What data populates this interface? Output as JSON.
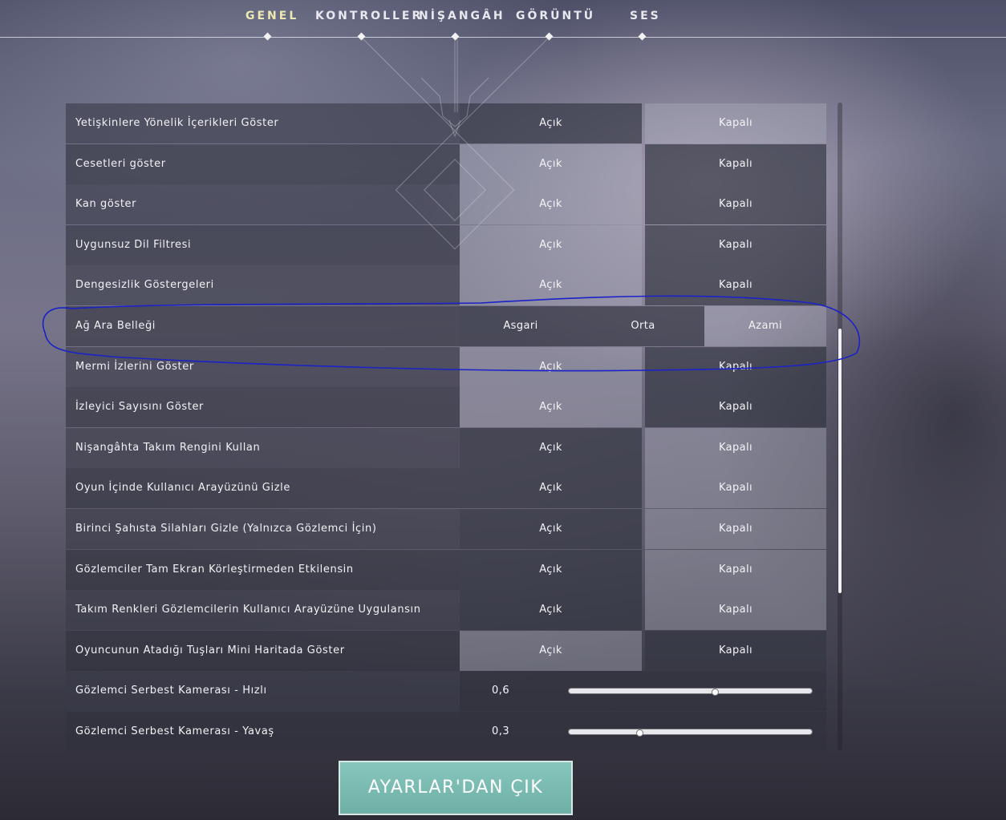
{
  "nav": {
    "tabs": [
      {
        "label": "GENEL",
        "active": true
      },
      {
        "label": "KONTROLLER",
        "active": false
      },
      {
        "label": "NİŞANGÂH",
        "active": false
      },
      {
        "label": "GÖRÜNTÜ",
        "active": false
      },
      {
        "label": "SES",
        "active": false
      }
    ]
  },
  "settings": {
    "rows": [
      {
        "label": "Yetişkinlere Yönelik İçerikleri Göster",
        "options": [
          "Açık",
          "Kapalı"
        ],
        "selected": 1
      },
      {
        "label": "Cesetleri göster",
        "options": [
          "Açık",
          "Kapalı"
        ],
        "selected": 0
      },
      {
        "label": "Kan göster",
        "options": [
          "Açık",
          "Kapalı"
        ],
        "selected": 0
      },
      {
        "label": "Uygunsuz Dil Filtresi",
        "options": [
          "Açık",
          "Kapalı"
        ],
        "selected": 0
      },
      {
        "label": "Dengesizlik Göstergeleri",
        "options": [
          "Açık",
          "Kapalı"
        ],
        "selected": 0
      },
      {
        "label": "Ağ Ara Belleği",
        "options": [
          "Asgari",
          "Orta",
          "Azami"
        ],
        "selected": 2
      },
      {
        "label": "Mermi İzlerini Göster",
        "options": [
          "Açık",
          "Kapalı"
        ],
        "selected": 0
      },
      {
        "label": "İzleyici Sayısını Göster",
        "options": [
          "Açık",
          "Kapalı"
        ],
        "selected": 0
      },
      {
        "label": "Nişangâhta Takım Rengini Kullan",
        "options": [
          "Açık",
          "Kapalı"
        ],
        "selected": 1
      },
      {
        "label": "Oyun İçinde Kullanıcı Arayüzünü Gizle",
        "options": [
          "Açık",
          "Kapalı"
        ],
        "selected": 1
      },
      {
        "label": "Birinci Şahısta Silahları Gizle (Yalnızca Gözlemci İçin)",
        "options": [
          "Açık",
          "Kapalı"
        ],
        "selected": 1
      },
      {
        "label": "Gözlemciler Tam Ekran Körleştirmeden Etkilensin",
        "options": [
          "Açık",
          "Kapalı"
        ],
        "selected": 1
      },
      {
        "label": "Takım Renkleri Gözlemcilerin Kullanıcı Arayüzüne Uygulansın",
        "options": [
          "Açık",
          "Kapalı"
        ],
        "selected": 1
      },
      {
        "label": "Oyuncunun Atadığı Tuşları Mini Haritada Göster",
        "options": [
          "Açık",
          "Kapalı"
        ],
        "selected": 0
      }
    ],
    "sliders": [
      {
        "label": "Gözlemci Serbest Kamerası - Hızlı",
        "value": "0,6",
        "fraction": 0.6
      },
      {
        "label": "Gözlemci Serbest Kamerası - Yavaş",
        "value": "0,3",
        "fraction": 0.29
      }
    ]
  },
  "scroll": {
    "position": 0.59
  },
  "exit": {
    "label": "AYARLAR'DAN ÇIK"
  },
  "colors": {
    "active_tab": "#ece8b0",
    "exit_button": "#7abcb2",
    "annotation": "#1a22c8"
  }
}
